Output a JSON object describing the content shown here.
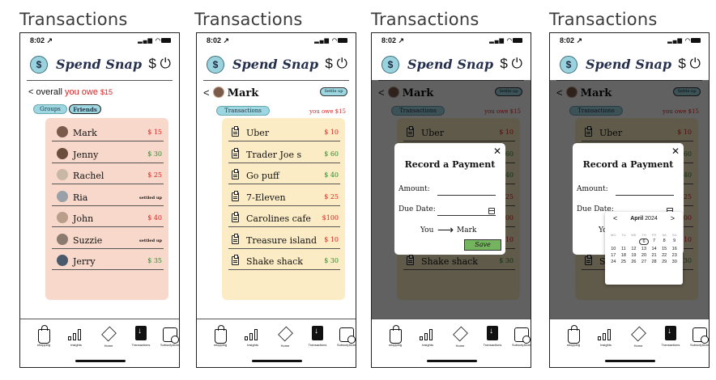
{
  "frame_title": "Transactions",
  "status": {
    "time": "8:02 ↗",
    "signal": "▂▄▆ ◠"
  },
  "app": {
    "name": "Spend Snap",
    "logo": "$",
    "dollar": "$",
    "power": "⏻"
  },
  "overall": {
    "chev": "<",
    "prefix": "overall ",
    "you_owe": "you owe ",
    "amount": "$15"
  },
  "filters": {
    "groups": "Groups",
    "friends": "Friends"
  },
  "friends": [
    {
      "name": "Mark",
      "amount": "$ 15",
      "status": "red",
      "avatar_color": "#7a5a4a"
    },
    {
      "name": "Jenny",
      "amount": "$ 30",
      "status": "green",
      "avatar_color": "#6b4e3d"
    },
    {
      "name": "Rachel",
      "amount": "$ 25",
      "status": "red",
      "avatar_color": "#c9b7a5"
    },
    {
      "name": "Ria",
      "amount": "settled up",
      "status": "settled",
      "avatar_color": "#9aa0a8"
    },
    {
      "name": "John",
      "amount": "$ 40",
      "status": "red",
      "avatar_color": "#b99e8c"
    },
    {
      "name": "Suzzie",
      "amount": "settled up",
      "status": "settled",
      "avatar_color": "#8a7a70"
    },
    {
      "name": "Jerry",
      "amount": "$ 35",
      "status": "green",
      "avatar_color": "#4a5a6a"
    }
  ],
  "detail": {
    "chev": "<",
    "name": "Mark",
    "settle": "Settle up",
    "tab": "Transactions",
    "you_owe": "you owe $15"
  },
  "transactions": [
    {
      "name": "Uber",
      "amount": "$ 10",
      "status": "red"
    },
    {
      "name": "Trader Joe s",
      "amount": "$ 60",
      "status": "green"
    },
    {
      "name": "Go puff",
      "amount": "$ 40",
      "status": "green"
    },
    {
      "name": "7-Eleven",
      "amount": "$ 25",
      "status": "red"
    },
    {
      "name": "Carolines cafe",
      "amount": "$100",
      "status": "red"
    },
    {
      "name": "Treasure island",
      "amount": "$ 10",
      "status": "red"
    },
    {
      "name": "Shake shack",
      "amount": "$ 30",
      "status": "green"
    }
  ],
  "modal": {
    "close": "✕",
    "title": "Record a Payment",
    "amount_label": "Amount:",
    "due_label": "Due Date:",
    "from": "You",
    "arrow": "⟶",
    "to": "Mark",
    "save": "Save"
  },
  "datepicker": {
    "month": "April",
    "year": "2024",
    "prev": "<",
    "next": ">",
    "weekdays": [
      "MO",
      "TU",
      "WE",
      "TH",
      "FR",
      "SA",
      "SU"
    ],
    "days": [
      {
        "d": "",
        "c": "dim"
      },
      {
        "d": "",
        "c": "dim"
      },
      {
        "d": "",
        "c": "dim"
      },
      {
        "d": "6",
        "c": "sel"
      },
      {
        "d": "7",
        "c": ""
      },
      {
        "d": "8",
        "c": ""
      },
      {
        "d": "9",
        "c": ""
      },
      {
        "d": "10",
        "c": ""
      },
      {
        "d": "11",
        "c": ""
      },
      {
        "d": "12",
        "c": ""
      },
      {
        "d": "13",
        "c": ""
      },
      {
        "d": "14",
        "c": ""
      },
      {
        "d": "15",
        "c": ""
      },
      {
        "d": "16",
        "c": ""
      },
      {
        "d": "17",
        "c": ""
      },
      {
        "d": "18",
        "c": ""
      },
      {
        "d": "19",
        "c": ""
      },
      {
        "d": "20",
        "c": ""
      },
      {
        "d": "21",
        "c": ""
      },
      {
        "d": "22",
        "c": ""
      },
      {
        "d": "23",
        "c": ""
      },
      {
        "d": "24",
        "c": ""
      },
      {
        "d": "25",
        "c": ""
      },
      {
        "d": "26",
        "c": ""
      },
      {
        "d": "27",
        "c": ""
      },
      {
        "d": "28",
        "c": ""
      },
      {
        "d": "29",
        "c": ""
      },
      {
        "d": "30",
        "c": ""
      }
    ]
  },
  "tabs": [
    "shopping",
    "Insights",
    "Home",
    "Transactions",
    "Subscriptions"
  ],
  "colors": {
    "red": "#dd2222",
    "green": "#2a8a2a",
    "accent": "#9dd8e2",
    "save": "#74b45e"
  }
}
